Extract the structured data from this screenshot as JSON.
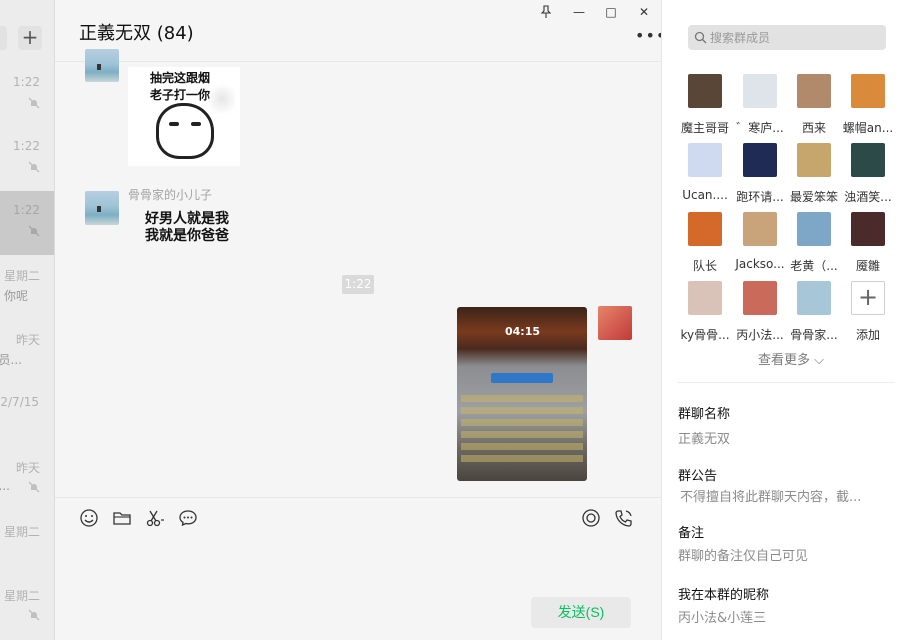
{
  "colors": {
    "accent_green": "#07c160",
    "panel_bg": "#ffffff",
    "chat_bg": "#f5f5f5",
    "muted_text": "#8c8c8c"
  },
  "session_list": {
    "add_label": "+",
    "items": [
      {
        "time": "1:22",
        "snippet": "",
        "muted": true
      },
      {
        "time": "1:22",
        "snippet": "",
        "muted": true
      },
      {
        "time": "1:22",
        "snippet": "",
        "muted": true,
        "selected": true
      },
      {
        "time": "星期二",
        "snippet": "你呢",
        "muted": false
      },
      {
        "time": "昨天",
        "snippet": "员...",
        "muted": false
      },
      {
        "time": "2/7/15",
        "snippet": "",
        "muted": false
      },
      {
        "time": "昨天",
        "snippet": "...",
        "muted": true
      },
      {
        "time": "星期二",
        "snippet": "",
        "muted": false
      },
      {
        "time": "星期二",
        "snippet": "",
        "muted": true
      }
    ]
  },
  "chat": {
    "title": "正義无双 (84)",
    "window_controls": {
      "pin": "pin-icon",
      "minimize": "—",
      "maximize": "□",
      "close": "✕"
    },
    "more": "•••",
    "messages": {
      "sticker_1_caption": [
        "抽完这跟烟",
        "老子打一你"
      ],
      "sender_name": "骨骨家的小儿子",
      "text_sticker": [
        "好男人就是我",
        "我就是你爸爸"
      ],
      "time_divider": "1:22",
      "game_timer": "04:15"
    },
    "toolbar_icons": [
      "emoji-icon",
      "folder-icon",
      "scissors-icon",
      "chat-bubble-icon",
      "live-icon",
      "voice-call-icon"
    ],
    "send_label": "发送(S)"
  },
  "info_panel": {
    "search_placeholder": "搜索群成员",
    "members": [
      {
        "name": "魔主哥哥",
        "avatar": "#5a4636"
      },
      {
        "name": "゛寒庐...",
        "avatar": "#dfe3ea"
      },
      {
        "name": "西来",
        "avatar": "#b08a6a"
      },
      {
        "name": "螺帽an...",
        "avatar": "#d98a3a"
      },
      {
        "name": "Ucan....",
        "avatar": "#cfd9ef"
      },
      {
        "name": "跑环请...",
        "avatar": "#1f2b55"
      },
      {
        "name": "最爱笨笨",
        "avatar": "#c7a66b"
      },
      {
        "name": "浊酒笑...",
        "avatar": "#2c4a48"
      },
      {
        "name": "队长",
        "avatar": "#d46a2a"
      },
      {
        "name": "Jackso...",
        "avatar": "#c9a47a"
      },
      {
        "name": "老黄（...",
        "avatar": "#7ea7c7"
      },
      {
        "name": "魇雛",
        "avatar": "#4a2a2a"
      },
      {
        "name": "ky骨骨...",
        "avatar": "#d9c3b8"
      },
      {
        "name": "丙小法...",
        "avatar": "#c96a5a"
      },
      {
        "name": "骨骨家...",
        "avatar": "#a7c7d8"
      }
    ],
    "add_label": "添加",
    "view_more": "查看更多 ⌵",
    "sections": [
      {
        "label": "群聊名称",
        "value": "正義无双"
      },
      {
        "label": "群公告",
        "value": "不得擅自将此群聊天内容，截..."
      },
      {
        "label": "备注",
        "value": "群聊的备注仅自己可见"
      },
      {
        "label": "我在本群的昵称",
        "value": "丙小法&小莲三"
      }
    ]
  }
}
